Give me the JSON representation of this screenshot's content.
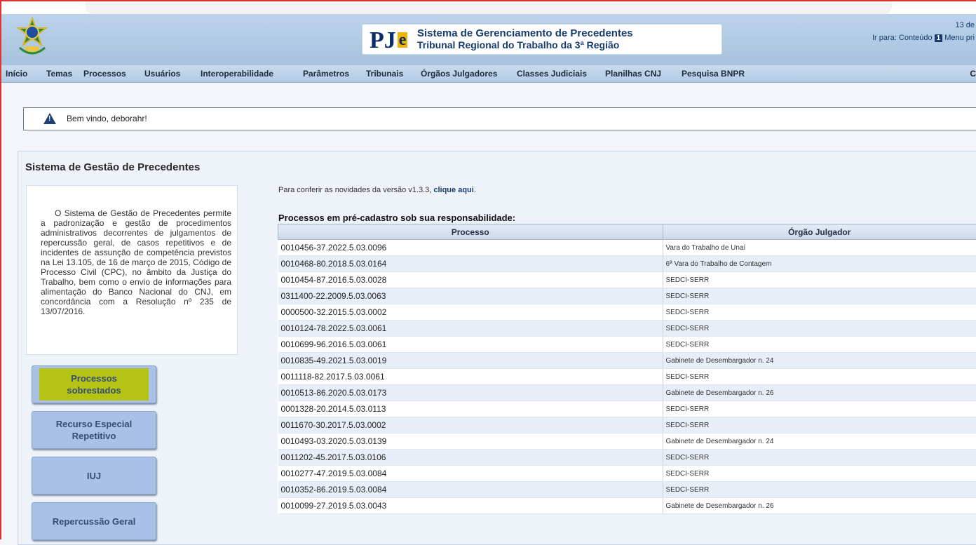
{
  "header": {
    "app_title": "Sistema de Gerenciamento de Precedentes",
    "court": "Tribunal Regional do Trabalho da 3ª Região",
    "date_partial": "13 de",
    "goto_label": "Ir para:",
    "goto_content": "Conteúdo",
    "goto_content_key": "1",
    "goto_menu": "Menu pri"
  },
  "menu": [
    "Início",
    "Temas",
    "Processos",
    "Usuários",
    "Interoperabilidade",
    "Parâmetros",
    "Tribunais",
    "Órgãos Julgadores",
    "Classes Judiciais",
    "Planilhas CNJ",
    "Pesquisa BNPR"
  ],
  "menu_cut": "C",
  "welcome": "Bem vindo, deborahr!",
  "section_title": "Sistema de Gestão de Precedentes",
  "description": "O Sistema de Gestão de Precedentes permite a padronização e gestão de procedimentos administrativos decorrentes de julgamentos de repercussão geral, de casos repetitivos e de incidentes de assunção de competência previstos na Lei 13.105, de 16 de março de 2015, Código de Processo Civil (CPC), no âmbito da Justiça do Trabalho, bem como o envio de informações para alimentação do Banco Nacional do CNJ, em concordância com a Resolução nº 235 de 13/07/2016.",
  "side_buttons": [
    "Processos sobrestados",
    "Recurso Especial Repetitivo",
    "IUJ",
    "Repercussão Geral"
  ],
  "notice_text": "Para conferir as novidades da versão v1.3.3, ",
  "notice_link": "clique aqui",
  "notice_end": ".",
  "table": {
    "caption": "Processos em pré-cadastro sob sua responsabilidade:",
    "headers": [
      "Processo",
      "Órgão Julgador"
    ],
    "rows": [
      [
        "0010456-37.2022.5.03.0096",
        "Vara do Trabalho de Unaí"
      ],
      [
        "0010468-80.2018.5.03.0164",
        "6ª Vara do Trabalho de Contagem"
      ],
      [
        "0010454-87.2016.5.03.0028",
        "SEDCI-SERR"
      ],
      [
        "0311400-22.2009.5.03.0063",
        "SEDCI-SERR"
      ],
      [
        "0000500-32.2015.5.03.0002",
        "SEDCI-SERR"
      ],
      [
        "0010124-78.2022.5.03.0061",
        "SEDCI-SERR"
      ],
      [
        "0010699-96.2016.5.03.0061",
        "SEDCI-SERR"
      ],
      [
        "0010835-49.2021.5.03.0019",
        "Gabinete de Desembargador n. 24"
      ],
      [
        "0011118-82.2017.5.03.0061",
        "SEDCI-SERR"
      ],
      [
        "0010513-86.2020.5.03.0173",
        "Gabinete de Desembargador n. 26"
      ],
      [
        "0001328-20.2014.5.03.0113",
        "SEDCI-SERR"
      ],
      [
        "0011670-30.2017.5.03.0002",
        "SEDCI-SERR"
      ],
      [
        "0010493-03.2020.5.03.0139",
        "Gabinete de Desembargador n. 24"
      ],
      [
        "0011202-45.2017.5.03.0106",
        "SEDCI-SERR"
      ],
      [
        "0010277-47.2019.5.03.0084",
        "SEDCI-SERR"
      ],
      [
        "0010352-86.2019.5.03.0084",
        "SEDCI-SERR"
      ],
      [
        "0010099-27.2019.5.03.0043",
        "Gabinete de Desembargador n. 26"
      ]
    ]
  }
}
